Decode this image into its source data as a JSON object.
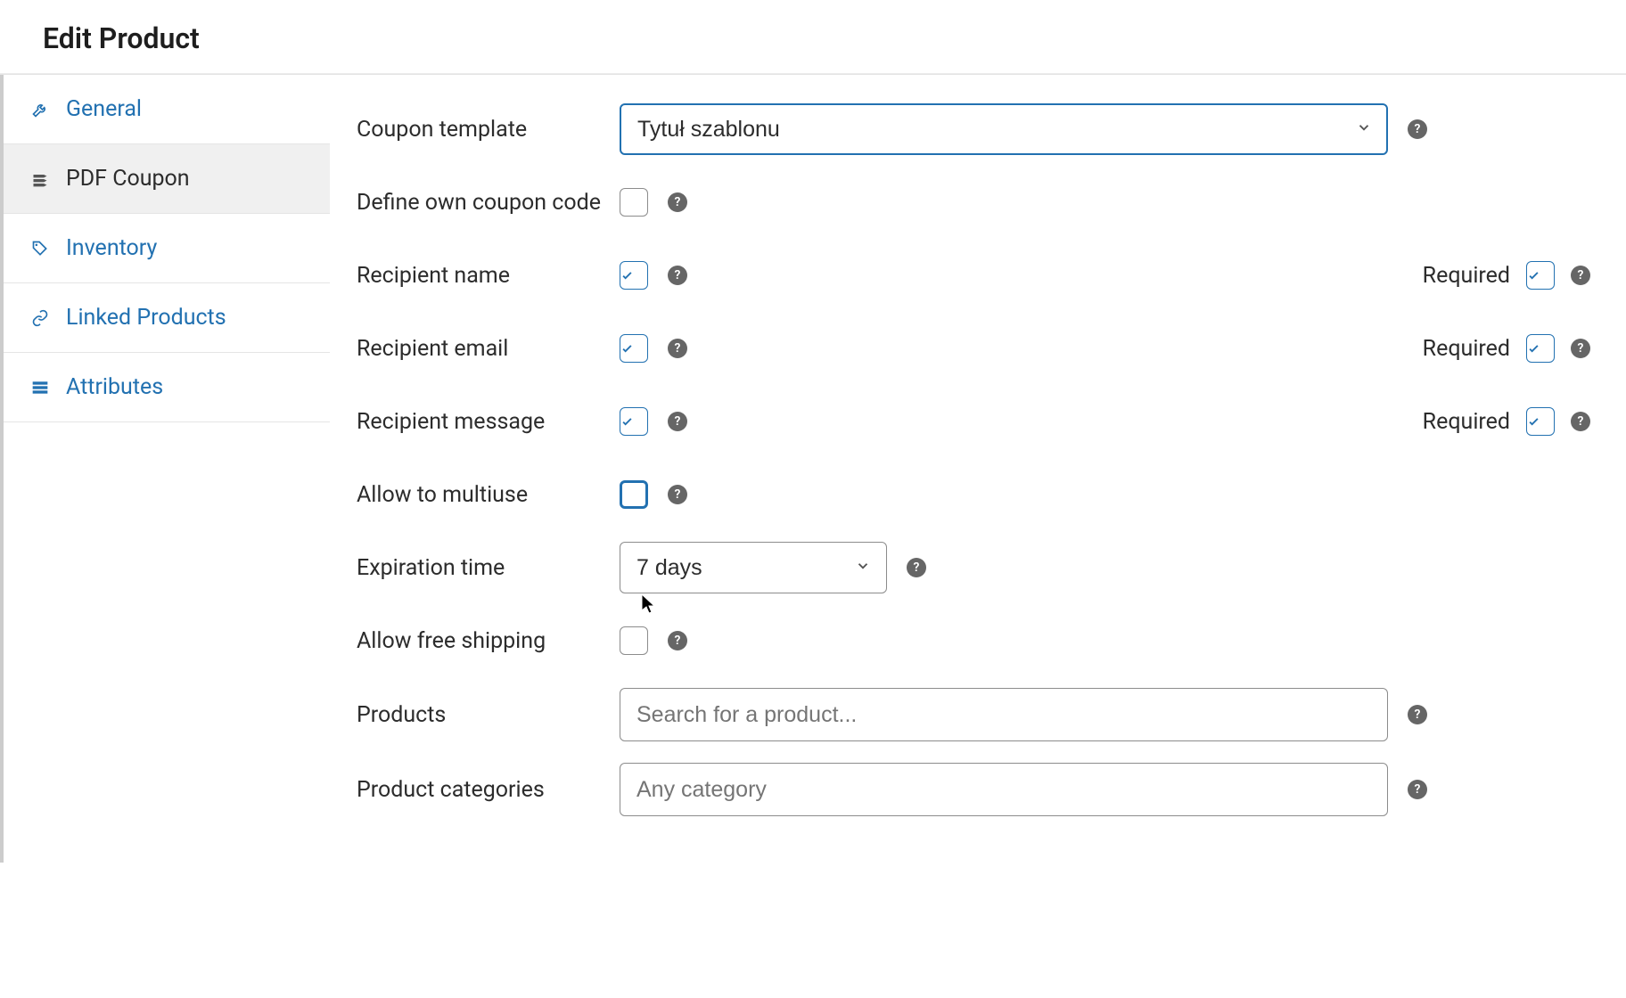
{
  "page_title": "Edit Product",
  "sidebar": {
    "items": [
      {
        "label": "General",
        "icon": "wrench"
      },
      {
        "label": "PDF Coupon",
        "icon": "stack"
      },
      {
        "label": "Inventory",
        "icon": "tag"
      },
      {
        "label": "Linked Products",
        "icon": "link"
      },
      {
        "label": "Attributes",
        "icon": "list"
      }
    ],
    "active_index": 1
  },
  "form": {
    "coupon_template": {
      "label": "Coupon template",
      "value": "Tytuł szablonu"
    },
    "define_own_code": {
      "label": "Define own coupon code",
      "checked": false
    },
    "recipient_name": {
      "label": "Recipient name",
      "checked": true,
      "required_label": "Required",
      "required_checked": true
    },
    "recipient_email": {
      "label": "Recipient email",
      "checked": true,
      "required_label": "Required",
      "required_checked": true
    },
    "recipient_message": {
      "label": "Recipient message",
      "checked": true,
      "required_label": "Required",
      "required_checked": true
    },
    "allow_multiuse": {
      "label": "Allow to multiuse",
      "checked": false
    },
    "expiration_time": {
      "label": "Expiration time",
      "value": "7 days"
    },
    "allow_free_shipping": {
      "label": "Allow free shipping",
      "checked": false
    },
    "products": {
      "label": "Products",
      "placeholder": "Search for a product..."
    },
    "product_categories": {
      "label": "Product categories",
      "placeholder": "Any category"
    }
  }
}
